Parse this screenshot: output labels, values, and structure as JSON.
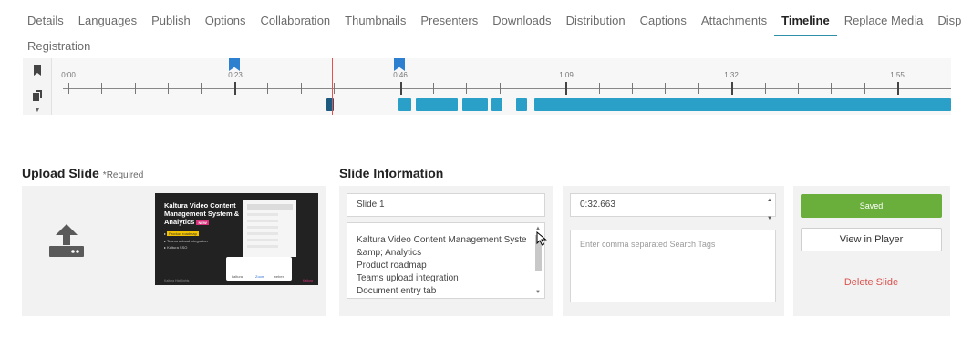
{
  "tabs": {
    "row1": [
      "Details",
      "Languages",
      "Publish",
      "Options",
      "Collaboration",
      "Thumbnails",
      "Presenters",
      "Downloads",
      "Distribution",
      "Captions",
      "Attachments",
      "Timeline",
      "Replace Media",
      "Display"
    ],
    "row2": [
      "Registration"
    ],
    "active": "Timeline"
  },
  "timeline": {
    "labels": [
      "0:00",
      "0:23",
      "0:46",
      "1:09",
      "1:32",
      "1:55"
    ],
    "side_icons": [
      "bookmark-icon",
      "slides-icon",
      "more-icon"
    ]
  },
  "upload": {
    "heading": "Upload Slide",
    "required": "*Required",
    "thumb": {
      "title": "Kaltura Video Content Management System & Analytics",
      "badge": "NEW",
      "items": [
        "Product roadmap",
        "Teams upload integration",
        "Kaltura SSO"
      ],
      "logos": [
        "kaltura",
        "Zoom",
        "webex"
      ],
      "footer": "Kaltura Highlights",
      "footer_right": "Kaltura"
    }
  },
  "info": {
    "heading": "Slide Information",
    "title_value": "Slide 1",
    "description_lines": [
      "Kaltura Video Content Management System",
      "&amp; Analytics",
      "Product roadmap",
      "Teams upload integration",
      "Document entry tab"
    ],
    "time_value": "0:32.663",
    "tags_placeholder": "Enter comma separated Search Tags"
  },
  "actions": {
    "saved": "Saved",
    "view": "View in Player",
    "delete": "Delete Slide"
  },
  "colors": {
    "accent": "#2d8fa8",
    "flag": "#2d7fd0",
    "slide_block": "#2aa0c8",
    "saved_green": "#6aaf3c",
    "delete_red": "#d9534f"
  }
}
